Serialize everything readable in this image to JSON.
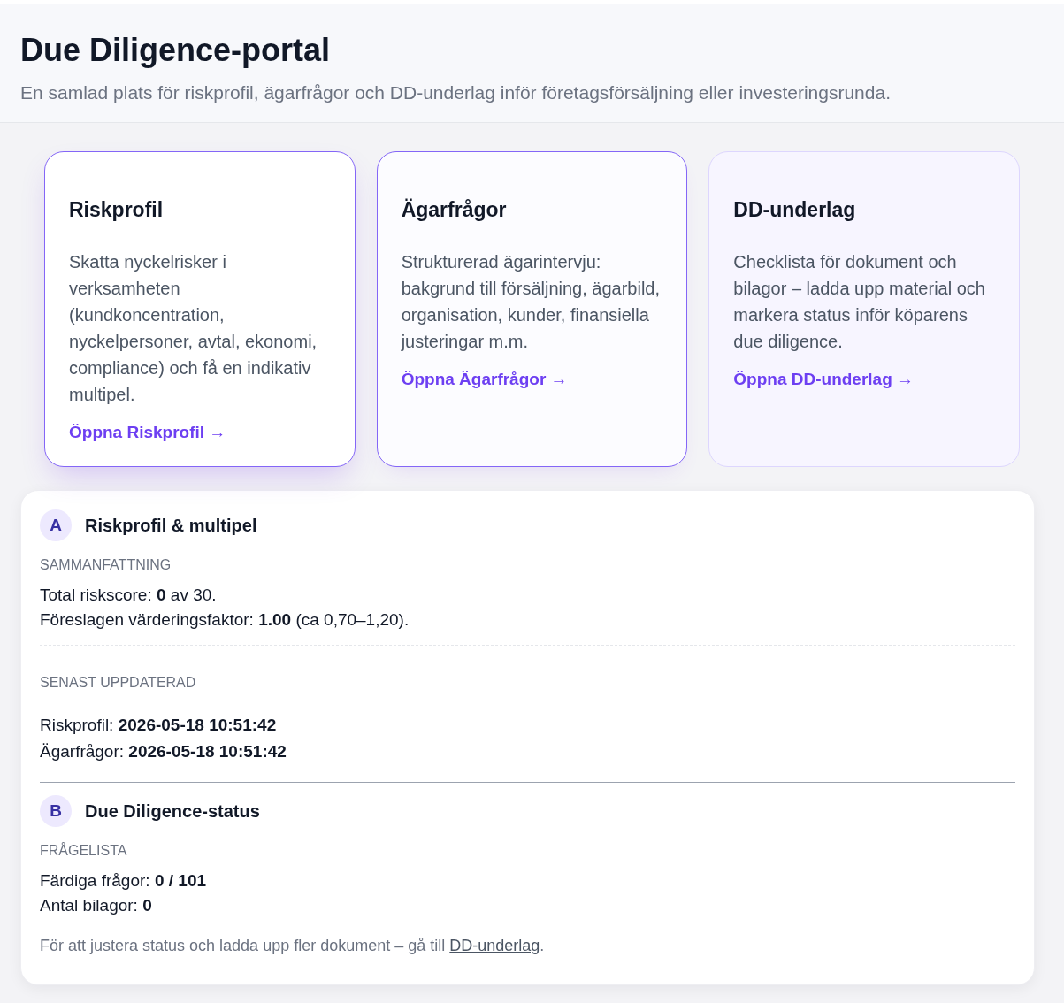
{
  "header": {
    "title": "Due Diligence-portal",
    "subtitle": "En samlad plats för riskprofil, ägarfrågor och DD-underlag inför företagsförsäljning eller investeringsrunda."
  },
  "cards": [
    {
      "title": "Riskprofil",
      "description": "Skatta nyckelrisker i verksamheten (kundkoncentration, nyckelpersoner, avtal, ekonomi, compliance) och få en indikativ multipel.",
      "link": "Öppna Riskprofil →",
      "selected": true,
      "highlighted": true
    },
    {
      "title": "Ägarfrågor",
      "description": "Strukturerad ägarintervju: bakgrund till försäljning, ägarbild, organisation, kunder, finansiella justeringar m.m.",
      "link": "Öppna Ägarfrågor →",
      "selected": false,
      "highlighted": true
    },
    {
      "title": "DD-underlag",
      "description": "Checklista för dokument och bilagor – ladda upp material och markera status inför köparens due diligence.",
      "link": "Öppna DD-underlag →",
      "selected": false,
      "highlighted": false
    }
  ],
  "sections": [
    {
      "badge": "A",
      "title": "Riskprofil & multipel",
      "groups": [
        {
          "label": "SAMMANFATTNING",
          "lines": [
            "Total riskscore: **0** av 30.",
            "Föreslagen värderingsfaktor: **1.00** (ca 0,70–1,20)."
          ]
        },
        {
          "label": "SENAST UPPDATERAD",
          "lines": [
            "Riskprofil: **2026-05-18 10:51:42**",
            "Ägarfrågor: **2026-05-18 10:51:42**"
          ]
        }
      ]
    },
    {
      "badge": "B",
      "title": "Due Diligence-status",
      "groups": [
        {
          "label": "FRÅGELISTA",
          "lines": [
            "Färdiga frågor: **0 / 101**",
            "Antal bilagor: **0**"
          ]
        }
      ],
      "note": {
        "text": "För att justera status och ladda upp fler dokument – gå till",
        "link": "DD-underlag",
        "end": "."
      }
    }
  ]
}
